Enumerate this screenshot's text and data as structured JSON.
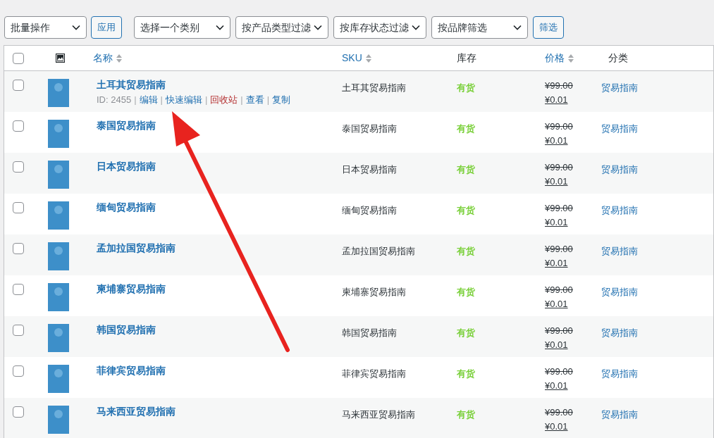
{
  "toolbar": {
    "bulk_action": {
      "value": "批量操作"
    },
    "apply_button": "应用",
    "filters": [
      {
        "value": "选择一个类别"
      },
      {
        "value": "按产品类型过滤"
      },
      {
        "value": "按库存状态过滤"
      },
      {
        "value": "按品牌筛选"
      }
    ],
    "filter_button": "筛选"
  },
  "table": {
    "columns": [
      {
        "kind": "checkbox",
        "checked": false
      },
      {
        "kind": "image"
      },
      {
        "kind": "sortable",
        "label": "名称"
      },
      {
        "kind": "sortable",
        "label": "SKU"
      },
      {
        "kind": "plain",
        "label": "库存"
      },
      {
        "kind": "sortable",
        "label": "价格"
      },
      {
        "kind": "plain",
        "label": "分类"
      }
    ],
    "row_actions_separator": "|",
    "rows": [
      {
        "checked": false,
        "name": "土耳其贸易指南",
        "actions": [
          {
            "kind": "meta",
            "label": "ID: 2455"
          },
          {
            "kind": "link",
            "label": "编辑"
          },
          {
            "kind": "link",
            "label": "快速编辑"
          },
          {
            "kind": "delete",
            "label": "回收站"
          },
          {
            "kind": "link",
            "label": "查看"
          },
          {
            "kind": "link",
            "label": "复制"
          }
        ],
        "sku": "土耳其贸易指南",
        "stock": "有货",
        "regular_price": "¥99.00",
        "sale_price": "¥0.01",
        "category": "贸易指南"
      },
      {
        "checked": false,
        "name": "泰国贸易指南",
        "sku": "泰国贸易指南",
        "stock": "有货",
        "regular_price": "¥99.00",
        "sale_price": "¥0.01",
        "category": "贸易指南"
      },
      {
        "checked": false,
        "name": "日本贸易指南",
        "sku": "日本贸易指南",
        "stock": "有货",
        "regular_price": "¥99.00",
        "sale_price": "¥0.01",
        "category": "贸易指南"
      },
      {
        "checked": false,
        "name": "缅甸贸易指南",
        "sku": "缅甸贸易指南",
        "stock": "有货",
        "regular_price": "¥99.00",
        "sale_price": "¥0.01",
        "category": "贸易指南"
      },
      {
        "checked": false,
        "name": "孟加拉国贸易指南",
        "sku": "孟加拉国贸易指南",
        "stock": "有货",
        "regular_price": "¥99.00",
        "sale_price": "¥0.01",
        "category": "贸易指南"
      },
      {
        "checked": false,
        "name": "柬埔寨贸易指南",
        "sku": "柬埔寨贸易指南",
        "stock": "有货",
        "regular_price": "¥99.00",
        "sale_price": "¥0.01",
        "category": "贸易指南"
      },
      {
        "checked": false,
        "name": "韩国贸易指南",
        "sku": "韩国贸易指南",
        "stock": "有货",
        "regular_price": "¥99.00",
        "sale_price": "¥0.01",
        "category": "贸易指南"
      },
      {
        "checked": false,
        "name": "菲律宾贸易指南",
        "sku": "菲律宾贸易指南",
        "stock": "有货",
        "regular_price": "¥99.00",
        "sale_price": "¥0.01",
        "category": "贸易指南"
      },
      {
        "checked": false,
        "name": "马来西亚贸易指南",
        "sku": "马来西亚贸易指南",
        "stock": "有货",
        "regular_price": "¥99.00",
        "sale_price": "¥0.01",
        "category": "贸易指南"
      }
    ]
  }
}
